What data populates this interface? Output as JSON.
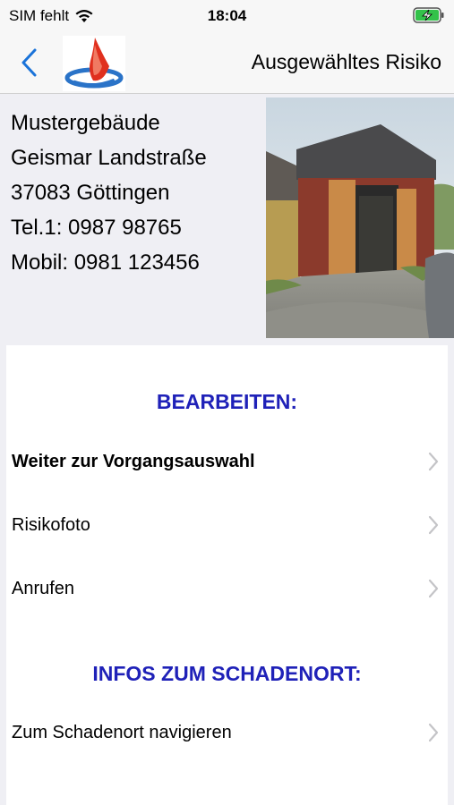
{
  "status_bar": {
    "carrier": "SIM fehlt",
    "time": "18:04",
    "icons": [
      "wifi-icon",
      "battery-charging-icon"
    ]
  },
  "nav": {
    "title": "Ausgewähltes Risiko",
    "back_icon": "chevron-left-icon"
  },
  "risk": {
    "name": "Mustergebäude",
    "street": "Geismar Landstraße",
    "city": "37083 Göttingen",
    "phone": "Tel.1: 0987 98765",
    "mobile": "Mobil: 0981 123456"
  },
  "sections": [
    {
      "title": "BEARBEITEN:",
      "items": [
        {
          "label": "Weiter zur Vorgangsauswahl",
          "bold": true
        },
        {
          "label": "Risikofoto",
          "bold": false
        },
        {
          "label": "Anrufen",
          "bold": false
        }
      ]
    },
    {
      "title": "INFOS ZUM SCHADENORT:",
      "items": [
        {
          "label": "Zum Schadenort navigieren",
          "bold": false
        }
      ]
    }
  ],
  "colors": {
    "section_title": "#1f21b8",
    "accent": "#1a73d9"
  }
}
